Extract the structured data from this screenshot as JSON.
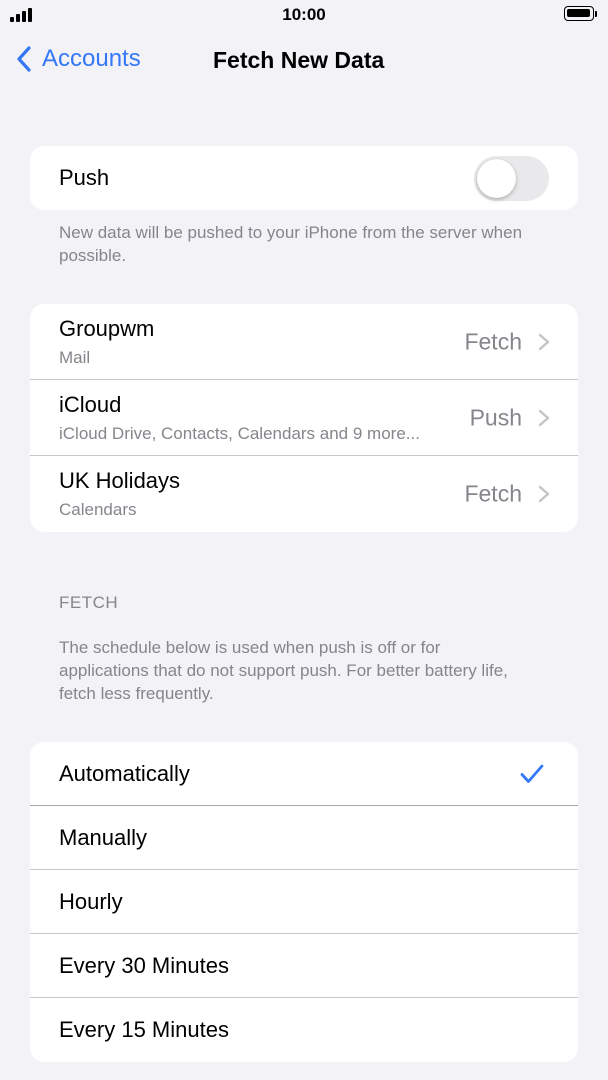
{
  "status_bar": {
    "time": "10:00",
    "signal_icon": "cellular-signal-icon",
    "battery_icon": "battery-icon"
  },
  "nav": {
    "back_label": "Accounts",
    "title": "Fetch New Data",
    "back_icon": "chevron-left-icon"
  },
  "push": {
    "label": "Push",
    "enabled": false,
    "footnote": "New data will be pushed to your iPhone from the server when possible."
  },
  "accounts": [
    {
      "name": "Groupwm",
      "detail": "Mail",
      "value": "Fetch"
    },
    {
      "name": "iCloud",
      "detail": "iCloud Drive, Contacts, Calendars and 9 more...",
      "value": "Push"
    },
    {
      "name": "UK Holidays",
      "detail": "Calendars",
      "value": "Fetch"
    }
  ],
  "fetch": {
    "header": "FETCH",
    "description": "The schedule below is used when push is off or for applications that do not support push. For better battery life, fetch less frequently.",
    "options": [
      {
        "label": "Automatically",
        "selected": true
      },
      {
        "label": "Manually",
        "selected": false
      },
      {
        "label": "Hourly",
        "selected": false
      },
      {
        "label": "Every 30 Minutes",
        "selected": false
      },
      {
        "label": "Every 15 Minutes",
        "selected": false
      }
    ]
  },
  "colors": {
    "accent": "#3478f6",
    "background": "#f2f2f7",
    "secondary_text": "#85858b",
    "toggle_off": "#e9e9eb"
  }
}
